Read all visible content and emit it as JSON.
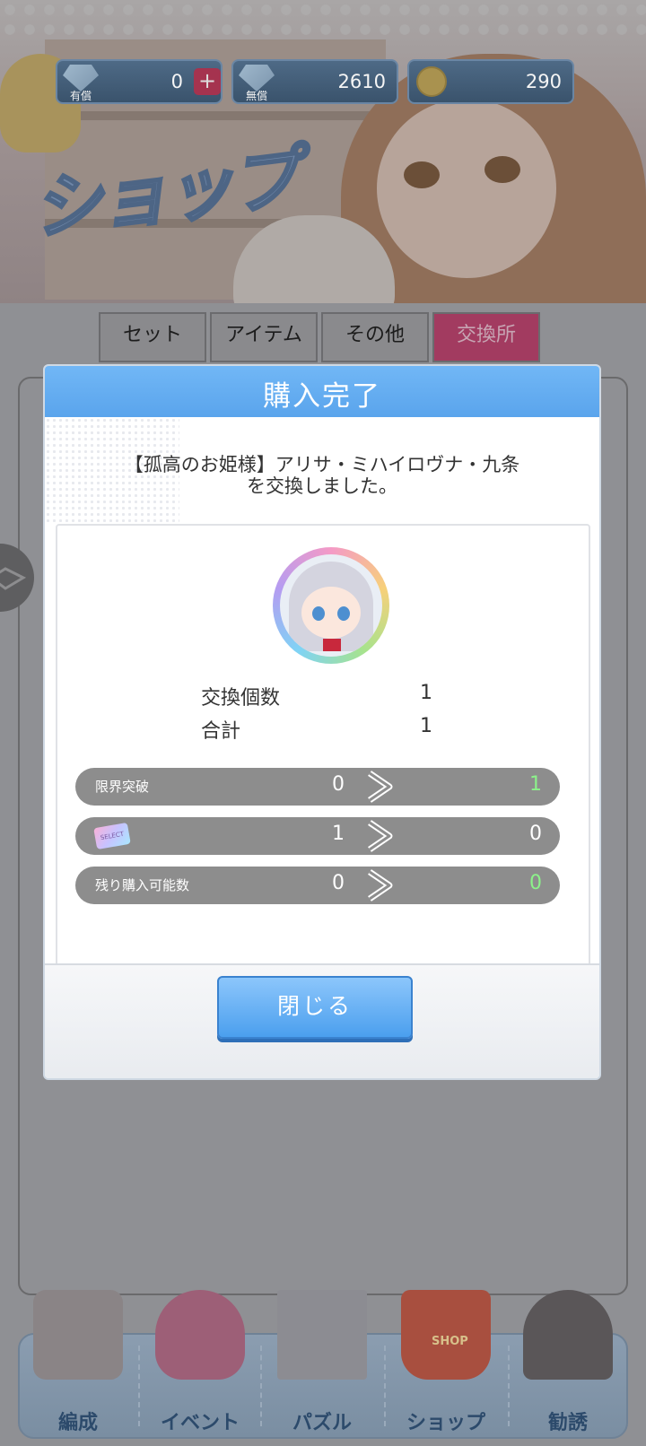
{
  "currencies": [
    {
      "label": "有償",
      "value": "0",
      "icon": "gem-icon",
      "has_add": true
    },
    {
      "label": "無償",
      "value": "2610",
      "icon": "gem-icon",
      "has_add": false
    },
    {
      "label": "",
      "value": "290",
      "icon": "coin-icon",
      "has_add": false
    }
  ],
  "banner": {
    "title": "ショップ"
  },
  "tabs": [
    {
      "label": "セット",
      "active": false
    },
    {
      "label": "アイテム",
      "active": false
    },
    {
      "label": "その他",
      "active": false
    },
    {
      "label": "交換所",
      "active": true
    }
  ],
  "modal": {
    "title": "購入完了",
    "message_line1": "【孤高のお姫様】アリサ・ミハイロヴナ・九条",
    "message_line2": "を交換しました。",
    "stats": [
      {
        "label": "交換個数",
        "value": "1"
      },
      {
        "label": "合計",
        "value": "1"
      }
    ],
    "rows": [
      {
        "label": "限界突破",
        "from": "0",
        "to": "1",
        "to_highlight": true,
        "icon": ""
      },
      {
        "label": "",
        "from": "1",
        "to": "0",
        "to_highlight": false,
        "icon": "select-ticket-icon"
      },
      {
        "label": "残り購入可能数",
        "from": "0",
        "to": "0",
        "to_highlight": true,
        "icon": ""
      }
    ],
    "ticket_text": "SELECT",
    "close_label": "閉じる"
  },
  "nav": [
    {
      "label": "編成",
      "icon": "characters-icon"
    },
    {
      "label": "イベント",
      "icon": "hearts-icon"
    },
    {
      "label": "パズル",
      "icon": "building-icon"
    },
    {
      "label": "ショップ",
      "icon": "shop-basket-icon",
      "tag": "SHOP"
    },
    {
      "label": "勧誘",
      "icon": "recruit-characters-icon"
    }
  ],
  "colors": {
    "header_blue": "#5aa4ec",
    "active_tab": "#e05a8a",
    "highlight_green": "#8cf28a"
  }
}
